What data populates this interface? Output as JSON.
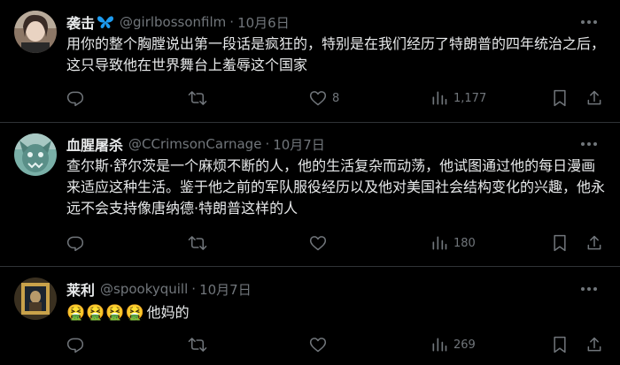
{
  "tweets": [
    {
      "name": "袭击",
      "handle": "@girlbossonfilm",
      "sep": "·",
      "date": "10月6日",
      "text": "用你的整个胸膛说出第一段话是疯狂的，特别是在我们经历了特朗普的四年统治之后，这只导致他在世界舞台上羞辱这个国家",
      "replies": "",
      "retweets": "",
      "likes": "8",
      "views": "1,177"
    },
    {
      "name": "血腥屠杀",
      "handle": "@CCrimsonCarnage",
      "sep": "·",
      "date": "10月7日",
      "text": "查尔斯·舒尔茨是一个麻烦不断的人，他的生活复杂而动荡，他试图通过他的每日漫画来适应这种生活。鉴于他之前的军队服役经历以及他对美国社会结构变化的兴趣，他永远不会支持像唐纳德·特朗普这样的人",
      "replies": "",
      "retweets": "",
      "likes": "",
      "views": "180"
    },
    {
      "name": "莱利",
      "handle": "@spookyquill",
      "sep": "·",
      "date": "10月7日",
      "text": "他妈的",
      "emoji": "🤮🤮🤮🤮",
      "replies": "",
      "retweets": "",
      "likes": "",
      "views": "269"
    }
  ],
  "colors": {
    "background": "#000000",
    "text": "#e7e9ea",
    "muted": "#71767b",
    "divider": "#2f3336",
    "badge": "#1d9bf0",
    "emoji": "#7cb342"
  },
  "icons": [
    "butterfly-icon",
    "more-icon",
    "reply-icon",
    "retweet-icon",
    "like-icon",
    "views-icon",
    "bookmark-icon",
    "share-icon"
  ]
}
